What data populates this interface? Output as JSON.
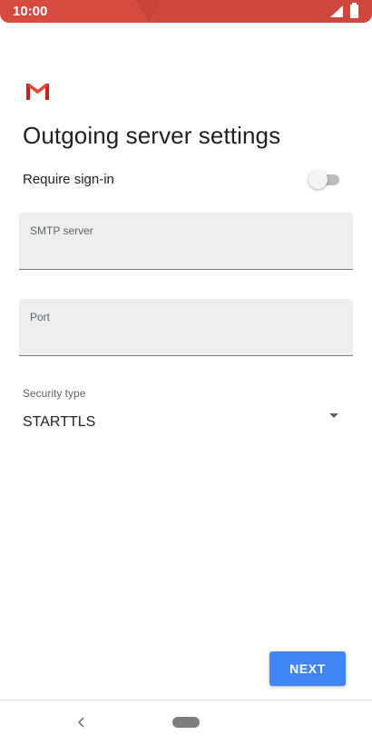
{
  "status_bar": {
    "time": "10:00",
    "color": "#d64a3f"
  },
  "app": {
    "logo": "gmail-logo"
  },
  "page": {
    "title": "Outgoing server settings"
  },
  "require_signin": {
    "label": "Require sign-in",
    "enabled": false
  },
  "smtp_server": {
    "label": "SMTP server",
    "value": ""
  },
  "port": {
    "label": "Port",
    "value": ""
  },
  "security_type": {
    "label": "Security type",
    "selected": "STARTTLS"
  },
  "actions": {
    "next_label": "NEXT",
    "accent": "#4285f4"
  },
  "navigation": {
    "back_icon": "chevron-left-icon",
    "home_icon": "home-pill-icon"
  }
}
